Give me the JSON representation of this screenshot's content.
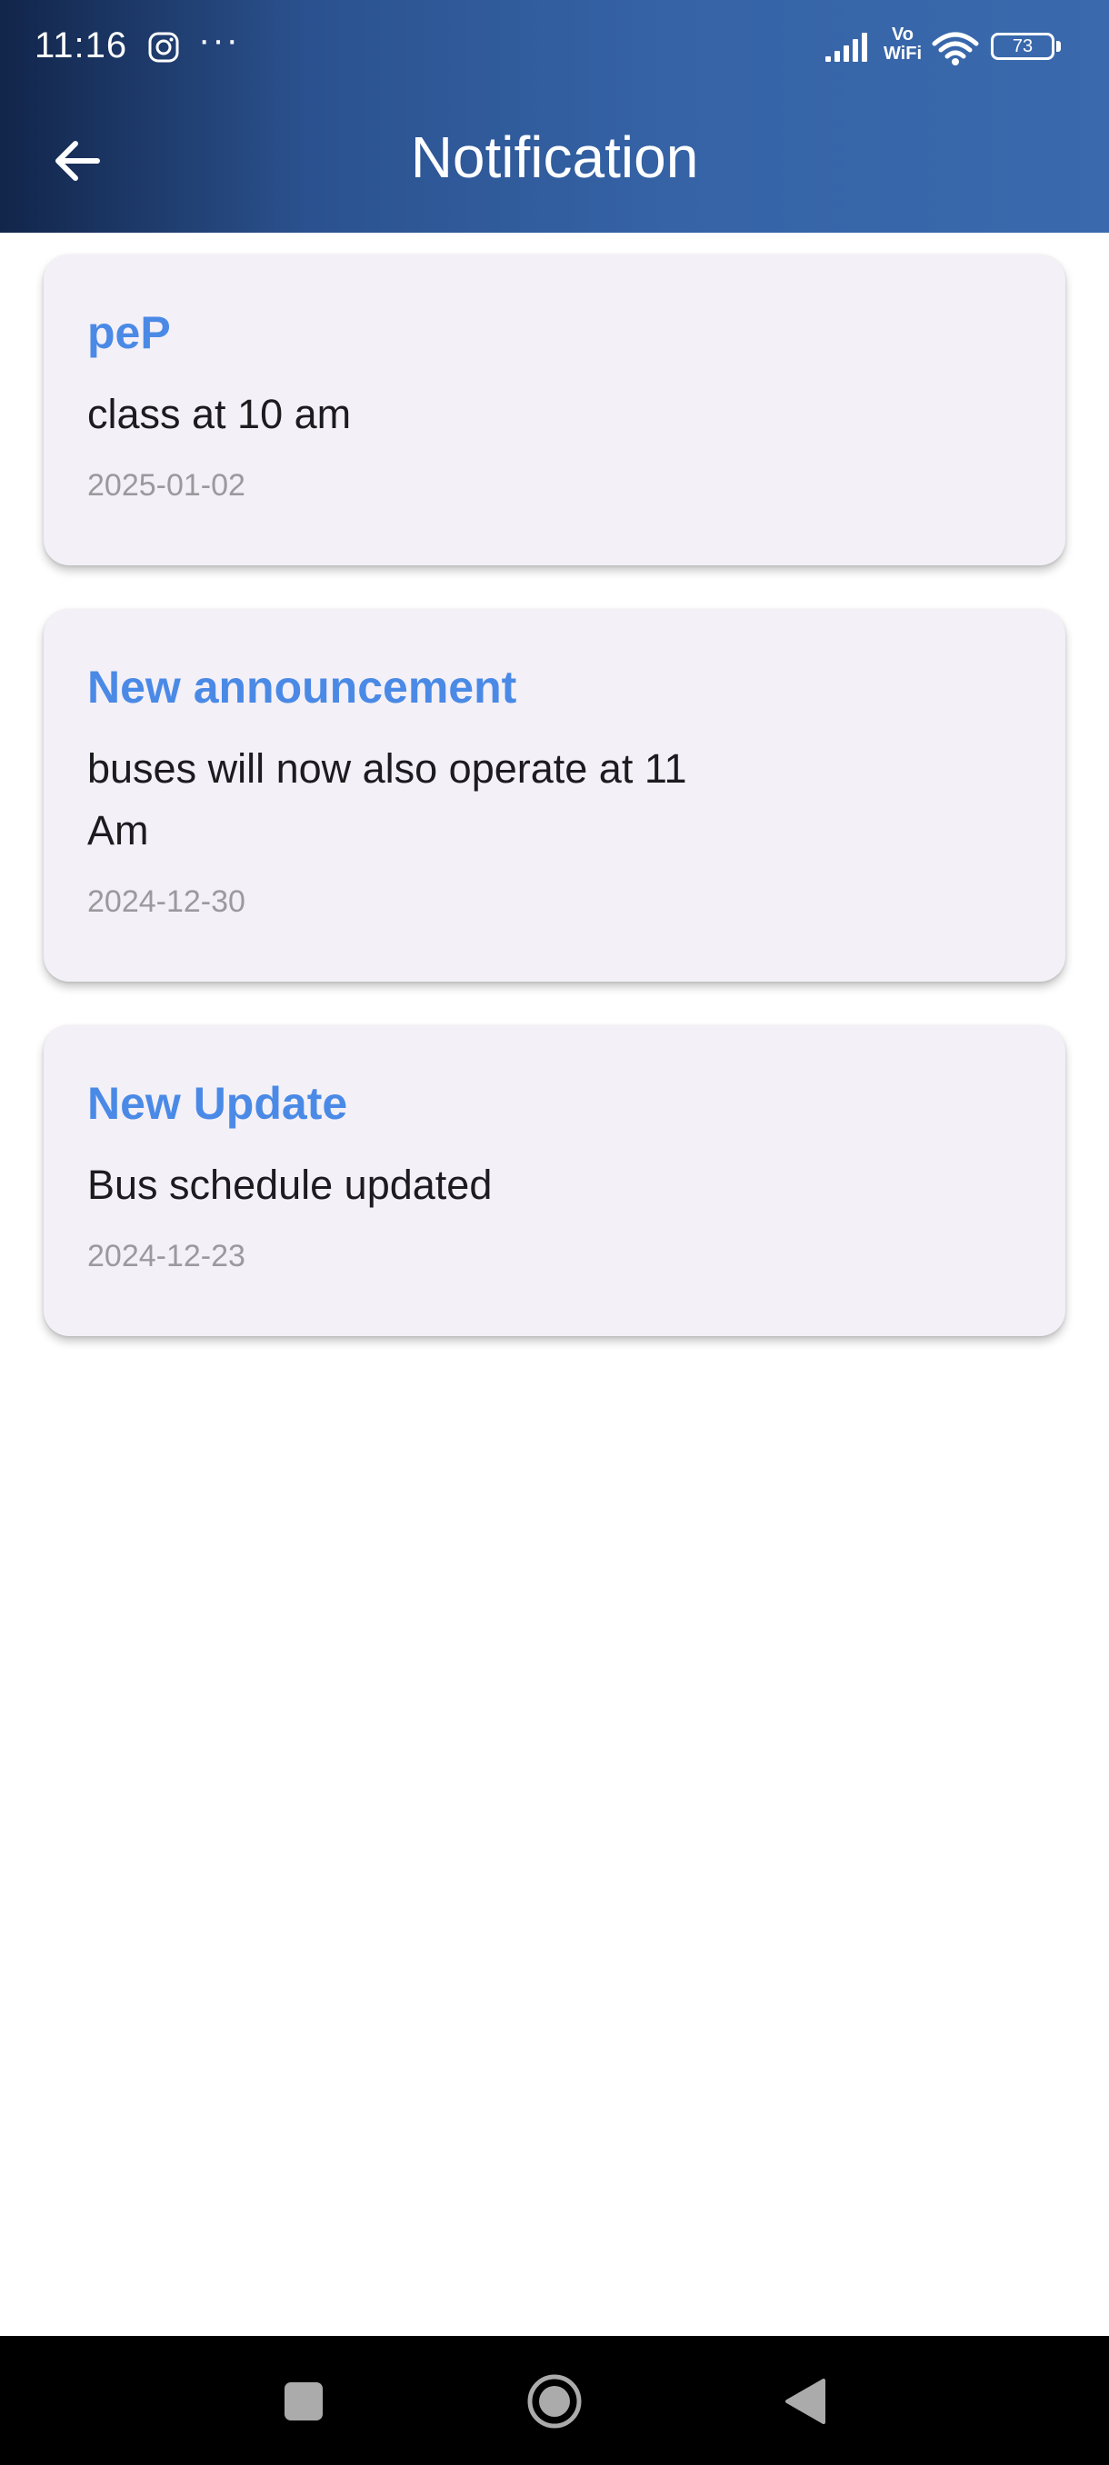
{
  "status_bar": {
    "time": "11:16",
    "icons": [
      "instagram-icon",
      "more-dots-icon",
      "signal-icon",
      "vowifi-icon",
      "wifi-icon",
      "battery-icon"
    ],
    "overflow_indicator": "···",
    "vowifi_label_top": "Vo",
    "vowifi_label_bottom": "WiFi",
    "battery_level": "73"
  },
  "header": {
    "back_icon": "arrow-left-icon",
    "title": "Notification",
    "gradient_colors": [
      "#12254a",
      "#3a69ad"
    ]
  },
  "notifications": [
    {
      "title": "peP",
      "message": "class at 10 am",
      "date": "2025-01-02"
    },
    {
      "title": "New announcement",
      "message": "buses will now also operate at 11 Am",
      "date": "2024-12-30"
    },
    {
      "title": "New Update",
      "message": "Bus schedule updated",
      "date": "2024-12-23"
    }
  ],
  "colors": {
    "notification_title": "#4a8ae6",
    "card_background": "#f4f0f7",
    "date_text": "#9a9a9e"
  },
  "nav_bar": {
    "buttons": [
      "recents-square-icon",
      "home-circle-icon",
      "back-triangle-icon"
    ]
  }
}
